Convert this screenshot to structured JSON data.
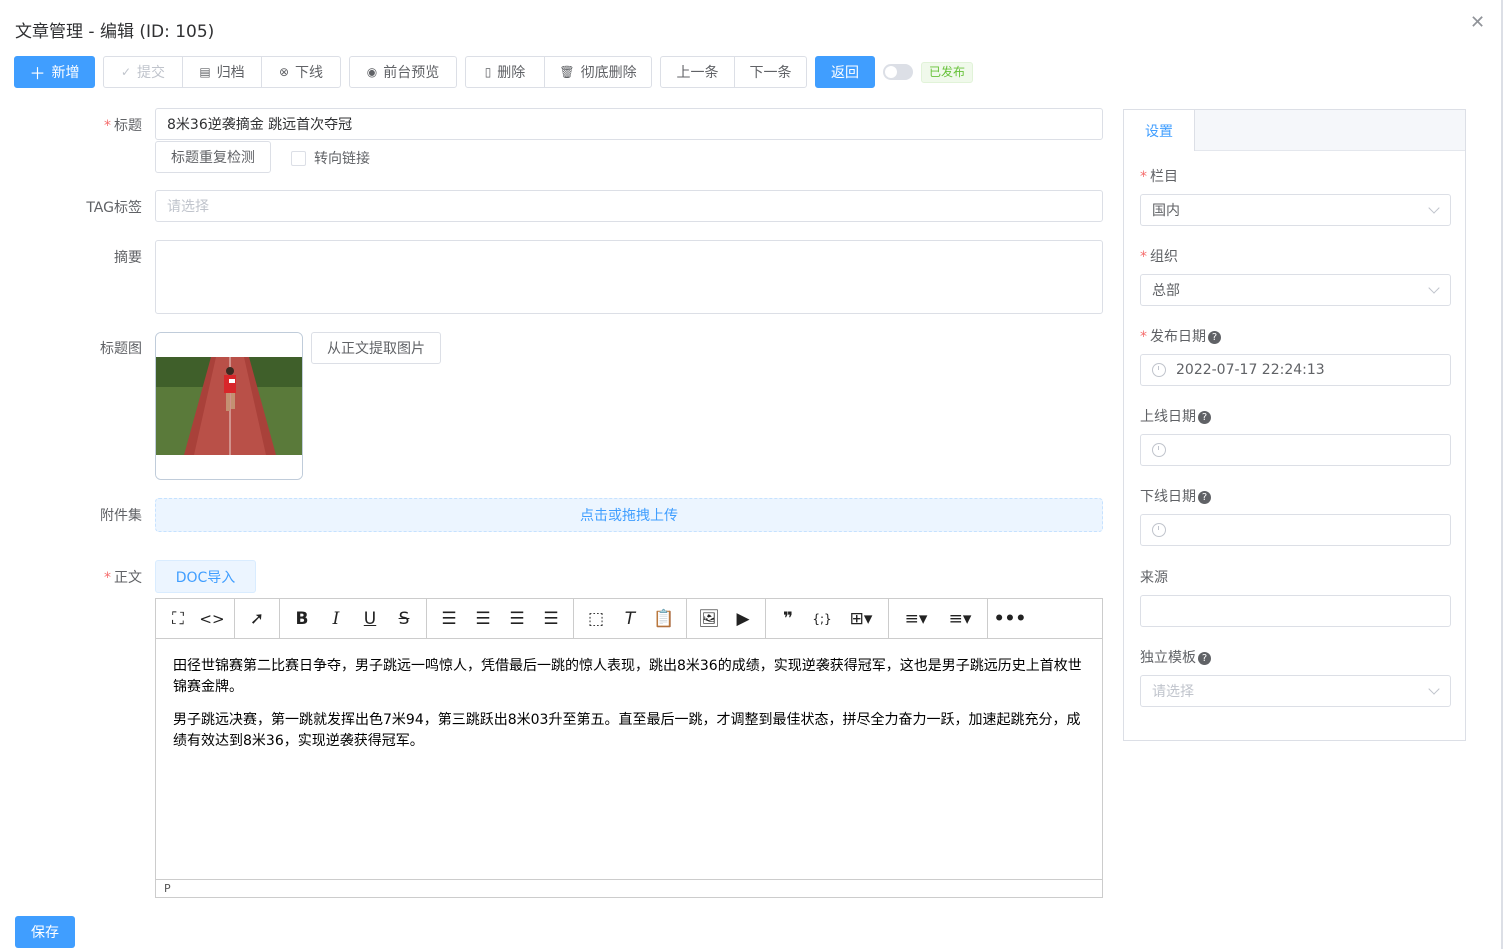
{
  "dialog": {
    "title": "文章管理 - 编辑 (ID: 105)"
  },
  "toolbar": {
    "new": "新增",
    "submit": "提交",
    "archive": "归档",
    "offline": "下线",
    "preview": "前台预览",
    "delete": "删除",
    "purge": "彻底删除",
    "prev": "上一条",
    "next": "下一条",
    "back": "返回",
    "status": "已发布"
  },
  "form": {
    "title_label": "标题",
    "title_value": "8米36逆袭摘金 跳远首次夺冠",
    "dup_check": "标题重复检测",
    "redirect_label": "转向链接",
    "tag_label": "TAG标签",
    "tag_placeholder": "请选择",
    "summary_label": "摘要",
    "thumb_label": "标题图",
    "extract_btn": "从正文提取图片",
    "attach_label": "附件集",
    "upload_text": "点击或拖拽上传",
    "body_label": "正文",
    "doc_import": "DOC导入"
  },
  "editor": {
    "paragraphs": [
      "田径世锦赛第二比赛日争夺，男子跳远一鸣惊人，凭借最后一跳的惊人表现，跳出8米36的成绩，实现逆袭获得冠军，这也是男子跳远历史上首枚世锦赛金牌。",
      "男子跳远决赛，第一跳就发挥出色7米94，第三跳跃出8米03升至第五。直至最后一跳，才调整到最佳状态，拼尽全力奋力一跃，加速起跳充分，成绩有效达到8米36，实现逆袭获得冠军。"
    ],
    "status_path": "P"
  },
  "save": "保存",
  "settings": {
    "tab": "设置",
    "column_label": "栏目",
    "column_value": "国内",
    "org_label": "组织",
    "org_value": "总部",
    "publish_label": "发布日期",
    "publish_value": "2022-07-17 22:24:13",
    "online_label": "上线日期",
    "offline_label": "下线日期",
    "source_label": "来源",
    "template_label": "独立模板",
    "template_placeholder": "请选择"
  },
  "colors": {
    "primary": "#409eff",
    "success": "#67c23a",
    "danger": "#f56c6c"
  }
}
